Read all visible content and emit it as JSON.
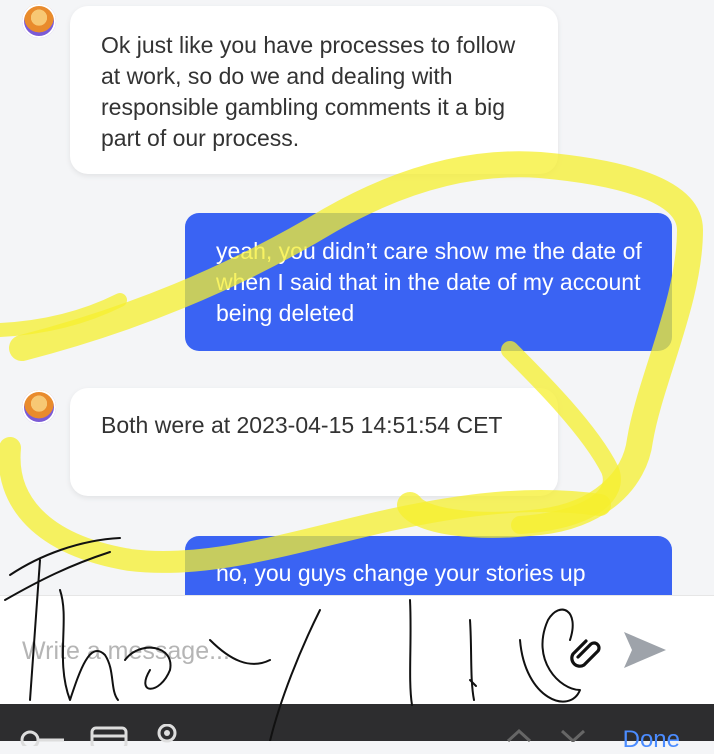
{
  "messages": [
    {
      "sender": "agent",
      "text": "Ok just like you have processes to follow at work, so do we and dealing with responsible gambling comments it a big part of our process."
    },
    {
      "sender": "user",
      "text": "yeah, you didn’t care show me the date of when I said that in the date of my account being deleted"
    },
    {
      "sender": "agent",
      "text": "Both were at 2023-04-15 14:51:54 CET"
    },
    {
      "sender": "user",
      "text": "no, you guys change your stories up"
    }
  ],
  "composer": {
    "placeholder": "Write a message...",
    "attach_icon": "paperclip-icon",
    "send_icon": "send-arrow-icon"
  },
  "keyboard_toolbar": {
    "icons": [
      "key-icon",
      "credit-card-icon",
      "location-pin-icon",
      "chevron-up-icon",
      "chevron-down-icon"
    ],
    "done_label": "Done"
  },
  "colors": {
    "user_bubble": "#3a63f3",
    "agent_bubble": "#ffffff",
    "highlighter": "#f5ef2e",
    "done": "#4b8cff"
  }
}
